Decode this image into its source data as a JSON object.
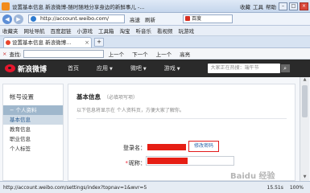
{
  "browser": {
    "title": "设置基本信息 新浪微博-随时随地分享身边的新鲜事儿 -...",
    "menu": [
      "收藏",
      "工具",
      "帮助"
    ],
    "url": "http://account.weibo.com/",
    "addr_actions": [
      "高速",
      "刷新"
    ],
    "search_placeholder": "百度",
    "favorites": [
      "收藏夹",
      "网址导航",
      "百度超链",
      "小游戏",
      "工具箱",
      "淘宝",
      "听音乐",
      "看视频",
      "玩游戏"
    ],
    "tab_label": "设置基本信息 新浪微博...",
    "findbar": {
      "label": "查找:",
      "previous": "上一个",
      "next": "下一个",
      "prev2": "上一个",
      "highlight": "高亮"
    }
  },
  "weibo": {
    "logo": "新浪微博",
    "nav": [
      "首页",
      "应用",
      "微吧",
      "游戏"
    ],
    "search_placeholder": "大家正在热搜：端午节"
  },
  "sidebar": {
    "title": "帐号设置",
    "group": "个人资料",
    "items": [
      "基本信息",
      "教育信息",
      "职业信息",
      "个人标签"
    ]
  },
  "main": {
    "heading": "基本信息",
    "subheading": "（必填项写项）",
    "note": "以下信息将显示在 个人资料页，方便大家了解你。",
    "login_label": "登录名：",
    "edit_password": "修改密码",
    "nick_label": "昵称："
  },
  "status": {
    "url": "http://account.weibo.com/settings/index?topnav=1&wvr=5",
    "speed": "15.51s",
    "zoom": "100%"
  },
  "watermark": "Baidu 经验"
}
